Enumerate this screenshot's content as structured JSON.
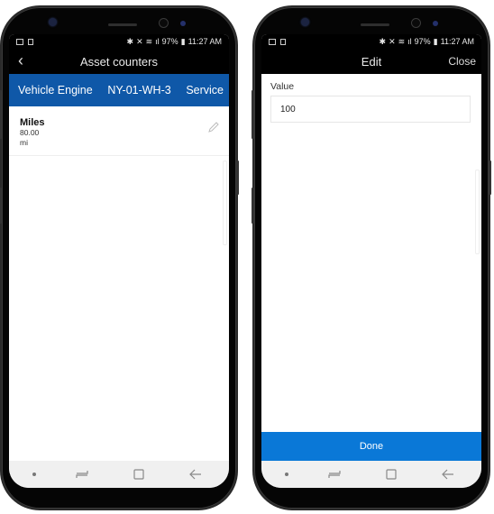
{
  "status_bar": {
    "battery": "97%",
    "time": "11:27 AM",
    "left_icons": [
      "image-icon",
      "sim-icon"
    ],
    "right_icons": [
      "bluetooth-icon",
      "mute-icon",
      "wifi-icon",
      "signal-icon",
      "battery-icon"
    ]
  },
  "screen_left": {
    "title": "Asset counters",
    "back_icon": "chevron-left-icon",
    "asset_header": {
      "asset_type": "Vehicle Engine",
      "asset_id": "NY-01-WH-3",
      "category": "Service"
    },
    "counters": [
      {
        "name": "Miles",
        "value": "80.00",
        "unit": "mi",
        "action_icon": "pencil-icon"
      }
    ]
  },
  "screen_right": {
    "title": "Edit",
    "close_label": "Close",
    "field_label": "Value",
    "field_value": "100",
    "done_label": "Done"
  },
  "nav_bar": {
    "icons": [
      "dot-icon",
      "recent-apps-icon",
      "home-icon",
      "back-arrow-icon"
    ]
  },
  "colors": {
    "header_blue": "#0f58a8",
    "done_blue": "#0a78d7"
  }
}
